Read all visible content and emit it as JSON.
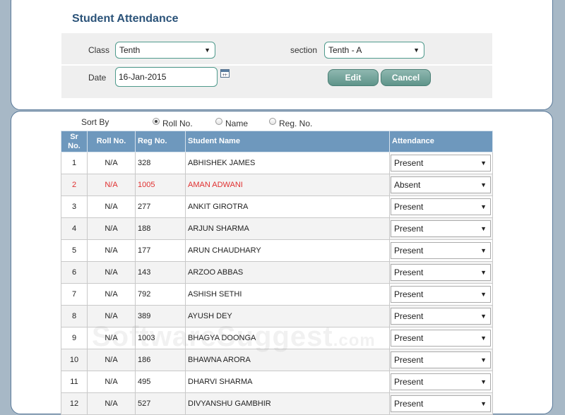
{
  "header": {
    "title": "Student Attendance"
  },
  "filters": {
    "class_label": "Class",
    "class_value": "Tenth",
    "section_label": "section",
    "section_value": "Tenth - A",
    "date_label": "Date",
    "date_value": "16-Jan-2015",
    "edit_label": "Edit",
    "cancel_label": "Cancel"
  },
  "sort": {
    "label": "Sort By",
    "options": [
      "Roll No.",
      "Name",
      "Reg. No."
    ],
    "selected": "Roll No."
  },
  "table": {
    "headers": {
      "sr": "Sr No.",
      "roll": "Roll No.",
      "reg": "Reg No.",
      "name": "Student Name",
      "attendance": "Attendance"
    },
    "rows": [
      {
        "sr": "1",
        "roll": "N/A",
        "reg": "328",
        "name": "ABHISHEK JAMES",
        "attendance": "Present"
      },
      {
        "sr": "2",
        "roll": "N/A",
        "reg": "1005",
        "name": "AMAN ADWANI",
        "attendance": "Absent"
      },
      {
        "sr": "3",
        "roll": "N/A",
        "reg": "277",
        "name": "ANKIT GIROTRA",
        "attendance": "Present"
      },
      {
        "sr": "4",
        "roll": "N/A",
        "reg": "188",
        "name": "ARJUN SHARMA",
        "attendance": "Present"
      },
      {
        "sr": "5",
        "roll": "N/A",
        "reg": "177",
        "name": "ARUN CHAUDHARY",
        "attendance": "Present"
      },
      {
        "sr": "6",
        "roll": "N/A",
        "reg": "143",
        "name": "ARZOO ABBAS",
        "attendance": "Present"
      },
      {
        "sr": "7",
        "roll": "N/A",
        "reg": "792",
        "name": "ASHISH SETHI",
        "attendance": "Present"
      },
      {
        "sr": "8",
        "roll": "N/A",
        "reg": "389",
        "name": "AYUSH DEY",
        "attendance": "Present"
      },
      {
        "sr": "9",
        "roll": "N/A",
        "reg": "1003",
        "name": "BHAGYA DOONGA",
        "attendance": "Present"
      },
      {
        "sr": "10",
        "roll": "N/A",
        "reg": "186",
        "name": "BHAWNA ARORA",
        "attendance": "Present"
      },
      {
        "sr": "11",
        "roll": "N/A",
        "reg": "495",
        "name": "DHARVI SHARMA",
        "attendance": "Present"
      },
      {
        "sr": "12",
        "roll": "N/A",
        "reg": "527",
        "name": "DIVYANSHU GAMBHIR",
        "attendance": "Present"
      }
    ]
  },
  "watermark": {
    "main": "SoftwareSuggest",
    "suffix": ".com"
  },
  "colors": {
    "accent": "#6e98bd",
    "button": "#5f948a",
    "absent": "#e03030",
    "title": "#2b5379"
  }
}
